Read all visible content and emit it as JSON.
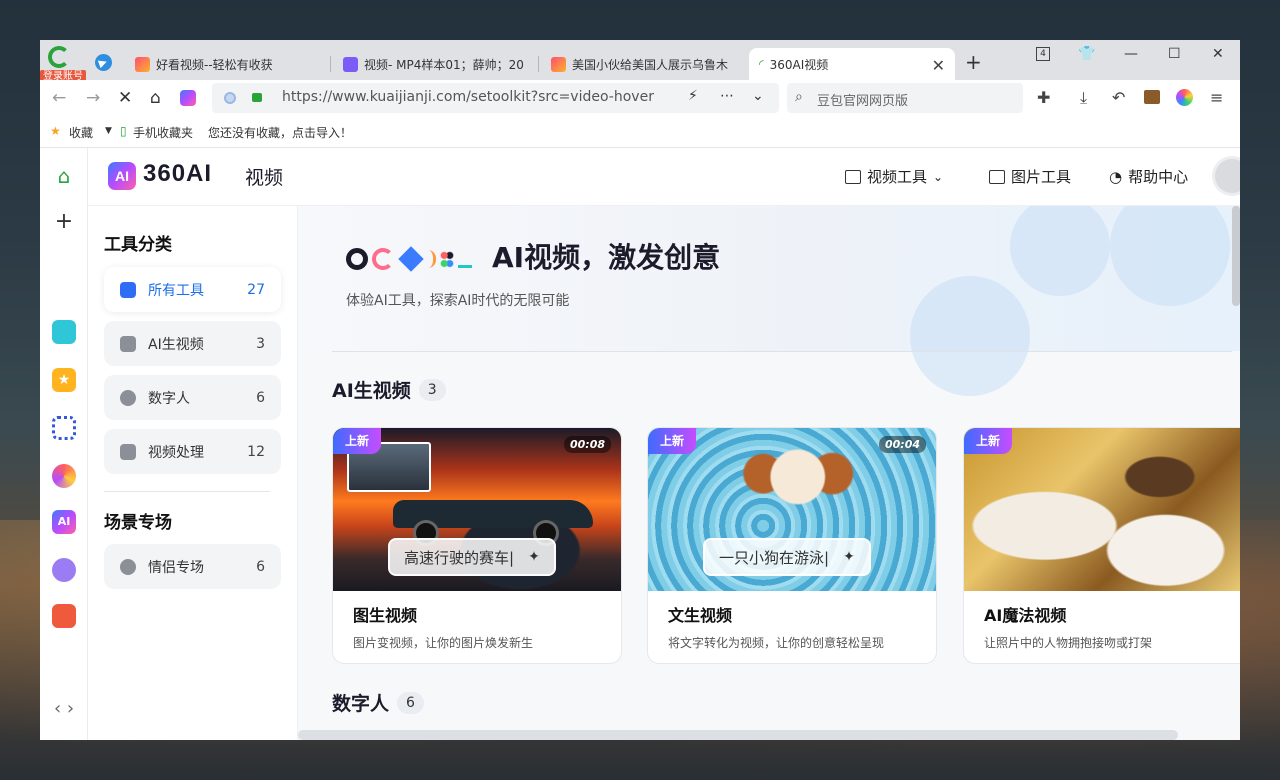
{
  "browser": {
    "login_badge": "登录账号",
    "tabs": [
      {
        "label": "好看视频--轻松有收获"
      },
      {
        "label": "视频- MP4样本01；薛帅；20"
      },
      {
        "label": "美国小伙给美国人展示乌鲁木"
      },
      {
        "label": "360AI视频"
      }
    ],
    "tab_count": "4",
    "url": "https://www.kuaijianji.com/setoolkit?src=video-hover",
    "search_placeholder": "豆包官网网页版"
  },
  "bookmarks": {
    "favorites": "收藏",
    "mobile": "手机收藏夹",
    "hint": "您还没有收藏，点击导入！"
  },
  "app": {
    "logo_badge": "AI",
    "logo_text": "360AI",
    "logo_sub": "视频",
    "nav": [
      {
        "label": "视频工具"
      },
      {
        "label": "图片工具"
      },
      {
        "label": "帮助中心"
      }
    ]
  },
  "sidebar": {
    "title": "工具分类",
    "items": [
      {
        "label": "所有工具",
        "count": "27"
      },
      {
        "label": "AI生视频",
        "count": "3"
      },
      {
        "label": "数字人",
        "count": "6"
      },
      {
        "label": "视频处理",
        "count": "12"
      }
    ],
    "scene_title": "场景专场",
    "scene_items": [
      {
        "label": "情侣专场",
        "count": "6"
      }
    ]
  },
  "hero": {
    "title": "AI视频，激发创意",
    "subtitle": "体验AI工具，探索AI时代的无限可能"
  },
  "sections": [
    {
      "title": "AI生视频",
      "count": "3"
    },
    {
      "title": "数字人",
      "count": "6"
    }
  ],
  "cards": [
    {
      "tag": "上新",
      "duration": "00:08",
      "prompt": "高速行驶的赛车|",
      "title": "图生视频",
      "desc": "图片变视频，让你的图片焕发新生"
    },
    {
      "tag": "上新",
      "duration": "00:04",
      "prompt": "一只小狗在游泳|",
      "title": "文生视频",
      "desc": "将文字转化为视频，让你的创意轻松呈现"
    },
    {
      "tag": "上新",
      "duration": "",
      "prompt": "",
      "title": "AI魔法视频",
      "desc": "让照片中的人物拥抱接吻或打架"
    }
  ],
  "colors": {
    "accent": "#1d6fe8",
    "tag_gradient_start": "#3f6bff",
    "tag_gradient_end": "#c54dff"
  }
}
